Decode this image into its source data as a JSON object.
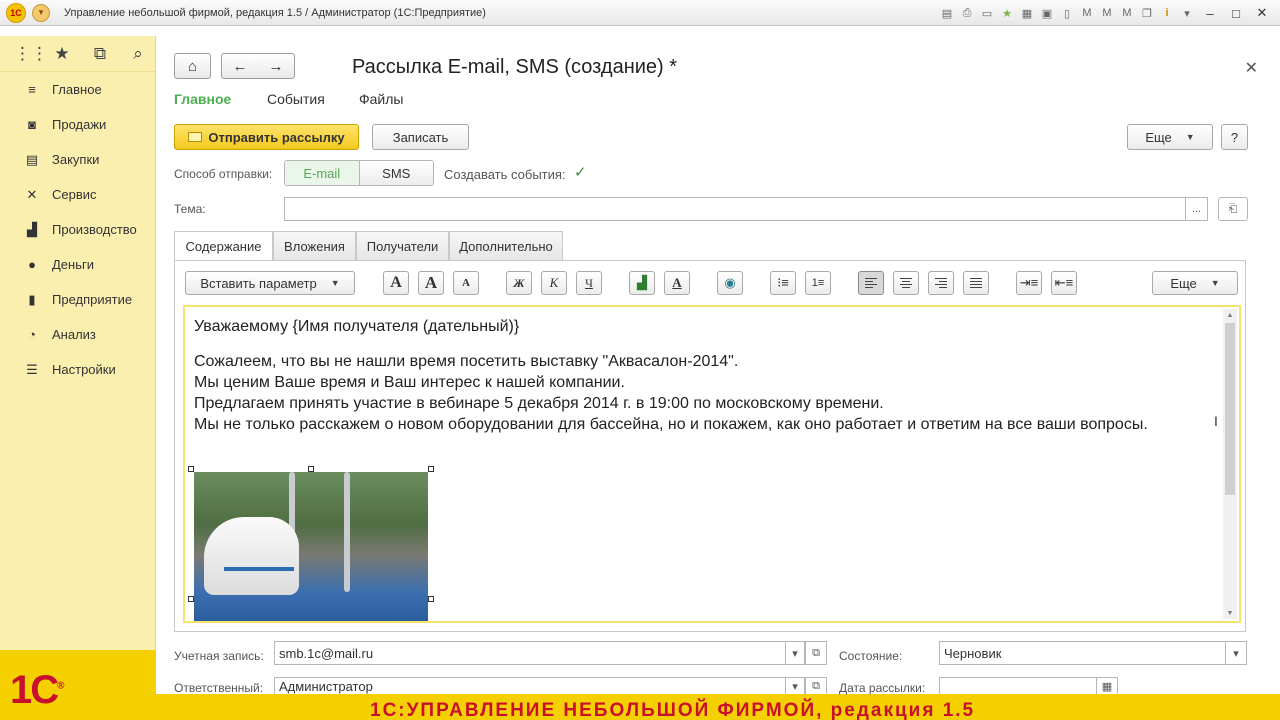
{
  "titlebar": {
    "logo": "1С",
    "title": "Управление небольшой фирмой, редакция 1.5 / Администратор  (1С:Предприятие)",
    "icons": [
      "save-icon",
      "print-icon",
      "preview-icon",
      "favorite-icon",
      "calendar-icon",
      "calculator-icon",
      "doc-icon",
      "memory-icon",
      "window-icon",
      "info-icon"
    ]
  },
  "sidebar": {
    "items": [
      {
        "label": "Главное",
        "icon": "menu-icon"
      },
      {
        "label": "Продажи",
        "icon": "bag-icon"
      },
      {
        "label": "Закупки",
        "icon": "cart-icon"
      },
      {
        "label": "Сервис",
        "icon": "tools-icon"
      },
      {
        "label": "Производство",
        "icon": "factory-icon"
      },
      {
        "label": "Деньги",
        "icon": "money-icon"
      },
      {
        "label": "Предприятие",
        "icon": "enterprise-icon"
      },
      {
        "label": "Анализ",
        "icon": "chart-icon"
      },
      {
        "label": "Настройки",
        "icon": "settings-icon"
      }
    ]
  },
  "form": {
    "title": "Рассылка E-mail, SMS (создание) *",
    "sections": [
      "Главное",
      "События",
      "Файлы"
    ],
    "send_button": "Отправить рассылку",
    "save_button": "Записать",
    "more_button": "Еще",
    "help_button": "?",
    "method_label": "Способ отправки:",
    "method_email": "E-mail",
    "method_sms": "SMS",
    "create_events_label": "Создавать события:",
    "subject_label": "Тема:",
    "subject_value": "",
    "subject_more": "...",
    "tabs": [
      "Содержание",
      "Вложения",
      "Получатели",
      "Дополнительно"
    ],
    "insert_param": "Вставить параметр",
    "editor_more": "Еще",
    "content": {
      "greeting": "Уважаемому {Имя получателя (дательный)}",
      "lines": [
        "Сожалеем, что вы не нашли время посетить выставку \"Аквасалон-2014\".",
        "Мы ценим Ваше время и Ваш интерес к нашей компании.",
        "Предлагаем принять участие в вебинаре 5 декабря 2014 г. в 19:00 по московскому времени.",
        "Мы не только расскажем о новом оборудовании для бассейна, но и покажем, как оно работает и ответим на все ваши вопросы."
      ]
    },
    "account_label": "Учетная запись:",
    "account_value": "smb.1c@mail.ru",
    "state_label": "Состояние:",
    "state_value": "Черновик",
    "responsible_label": "Ответственный:",
    "responsible_value": "Администратор",
    "date_label": "Дата рассылки:"
  },
  "footer": {
    "logo": "1С",
    "text": "1С:УПРАВЛЕНИЕ НЕБОЛЬШОЙ ФИРМОЙ, редакция 1.5"
  },
  "colors": {
    "accent_green": "#4caf50",
    "primary_yellow": "#f3c91f",
    "sidebar_bg": "#fbefb0",
    "brand_red": "#c8102e"
  }
}
